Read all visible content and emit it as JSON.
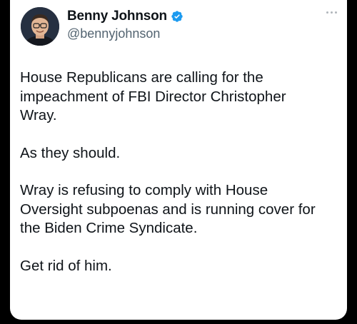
{
  "author": {
    "display_name": "Benny Johnson",
    "handle": "@bennyjohnson",
    "verified": true
  },
  "tweet": {
    "paragraphs": [
      "House Republicans are calling for the\nimpeachment of FBI Director Christopher\nWray.",
      "As they should.",
      "Wray is refusing to comply with House\nOversight subpoenas and is running cover for\nthe Biden Crime Syndicate.",
      "Get rid of him."
    ]
  },
  "icons": {
    "verified": "verified-badge-icon",
    "more": "more-options-icon"
  },
  "colors": {
    "verified_blue": "#1d9bf0",
    "text": "#0f1419",
    "secondary": "#536471"
  }
}
